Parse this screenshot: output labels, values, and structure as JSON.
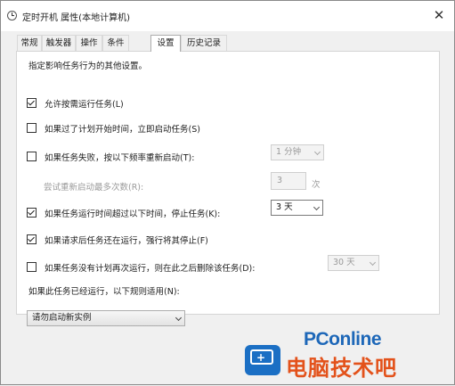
{
  "window": {
    "title": "定时开机 属性(本地计算机)",
    "close_glyph": "✕"
  },
  "tabs": [
    {
      "label": "常规"
    },
    {
      "label": "触发器"
    },
    {
      "label": "操作"
    },
    {
      "label": "条件"
    },
    {
      "label": "设置"
    },
    {
      "label": "历史记录"
    }
  ],
  "active_tab": "设置",
  "settings": {
    "description": "指定影响任务行为的其他设置。",
    "allow_on_demand": {
      "label": "允许按需运行任务(L)",
      "checked": true
    },
    "run_missed_start": {
      "label": "如果过了计划开始时间，立即启动任务(S)",
      "checked": false
    },
    "restart_on_failure": {
      "label": "如果任务失败，按以下频率重新启动(T):",
      "checked": false,
      "interval": "1 分钟"
    },
    "restart_attempts": {
      "label": "尝试重新启动最多次数(R):",
      "value": "3",
      "unit": "次"
    },
    "stop_if_longer": {
      "label": "如果任务运行时间超过以下时间，停止任务(K):",
      "checked": true,
      "duration": "3 天"
    },
    "force_stop": {
      "label": "如果请求后任务还在运行，强行将其停止(F)",
      "checked": true
    },
    "delete_if_not_scheduled": {
      "label": "如果任务没有计划再次运行，则在此之后删除该任务(D):",
      "checked": false,
      "after": "30 天"
    },
    "rule_label": "如果此任务已经运行，以下规则适用(N):",
    "rule_value": "请勿启动新实例"
  },
  "watermark": {
    "brand": "PConline",
    "name": "电脑技术吧",
    "icon_color": "#1b6fc4",
    "brand_color": "#1d67b8",
    "name_color": "#e3521b"
  }
}
